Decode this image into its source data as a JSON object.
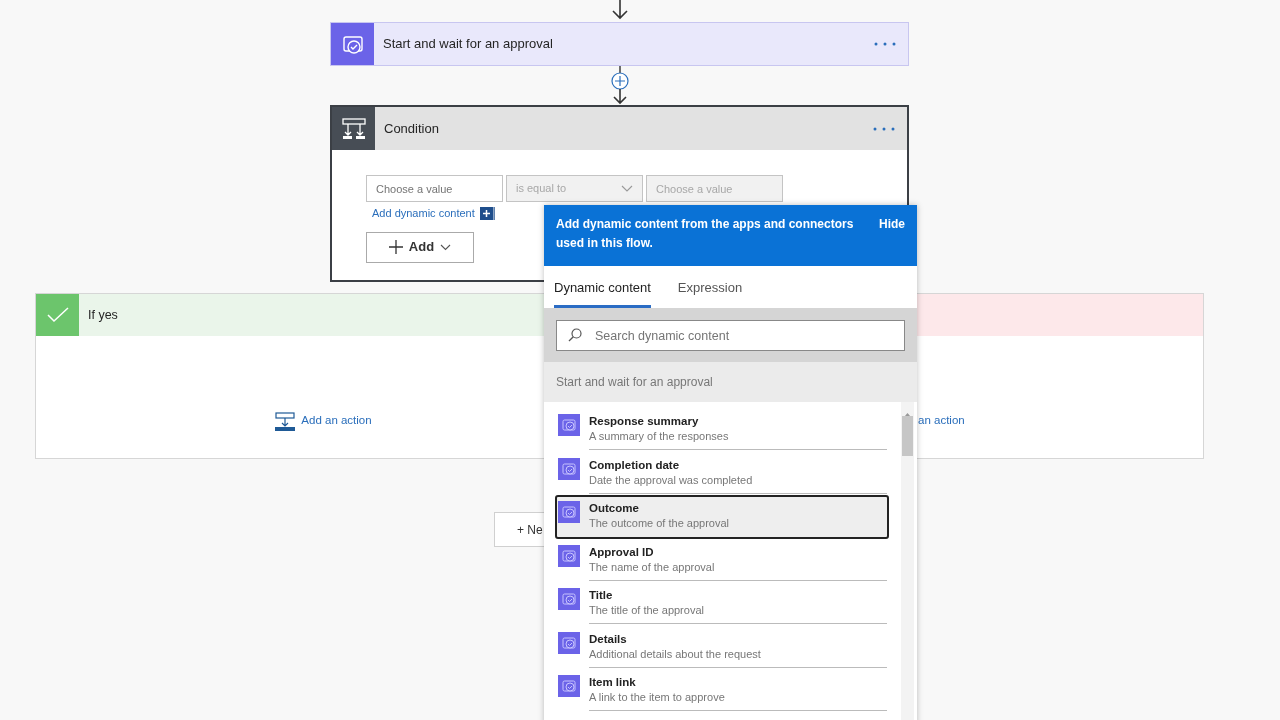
{
  "top_step": {
    "title": "Start and wait for an approval"
  },
  "condition": {
    "title": "Condition",
    "left_value": {
      "placeholder": "Choose a value",
      "disabled": false
    },
    "operator": {
      "value": "is equal to",
      "disabled": true
    },
    "right_value": {
      "placeholder": "Choose a value",
      "disabled": true
    },
    "dynamic_link": "Add dynamic content",
    "add_button": "Add"
  },
  "branches": [
    {
      "kind": "yes",
      "label": "If yes",
      "add_action": "Add an action"
    },
    {
      "kind": "no",
      "add_action": "an action"
    }
  ],
  "new_step_button": "+ Ne",
  "dynamic_panel": {
    "banner": "Add dynamic content from the apps and connectors used in this flow.",
    "hide": "Hide",
    "tabs": [
      {
        "label": "Dynamic content",
        "selected": true
      },
      {
        "label": "Expression",
        "selected": false
      }
    ],
    "search": {
      "placeholder": "Search dynamic content"
    },
    "section": "Start and wait for an approval",
    "items": [
      {
        "title": "Response summary",
        "description": "A summary of the responses",
        "selected": false
      },
      {
        "title": "Completion date",
        "description": "Date the approval was completed",
        "selected": false
      },
      {
        "title": "Outcome",
        "description": "The outcome of the approval",
        "selected": true
      },
      {
        "title": "Approval ID",
        "description": "The name of the approval",
        "selected": false
      },
      {
        "title": "Title",
        "description": "The title of the approval",
        "selected": false
      },
      {
        "title": "Details",
        "description": "Additional details about the request",
        "selected": false
      },
      {
        "title": "Item link",
        "description": "A link to the item to approve",
        "selected": false
      }
    ]
  }
}
